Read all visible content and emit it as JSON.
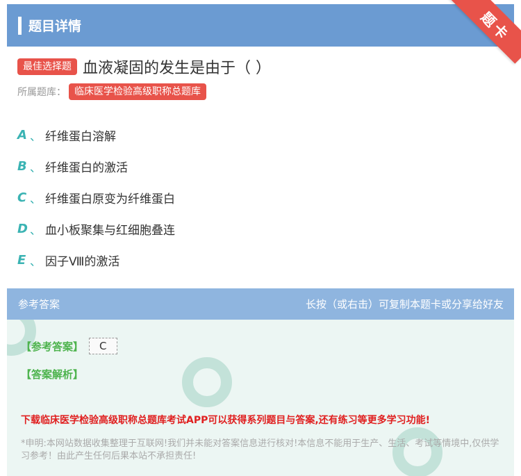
{
  "header": {
    "title": "题目详情"
  },
  "corner": {
    "label": "题卡"
  },
  "question": {
    "type_badge": "最佳选择题",
    "text": "血液凝固的发生是由于（ ）",
    "bank_label": "所属题库：",
    "bank_name": "临床医学检验高级职称总题库"
  },
  "options": [
    {
      "letter": "A",
      "sep": "、",
      "text": "纤维蛋白溶解"
    },
    {
      "letter": "B",
      "sep": "、",
      "text": "纤维蛋白的激活"
    },
    {
      "letter": "C",
      "sep": "、",
      "text": "纤维蛋白原变为纤维蛋白"
    },
    {
      "letter": "D",
      "sep": "、",
      "text": "血小板聚集与红细胞叠连"
    },
    {
      "letter": "E",
      "sep": "、",
      "text": "因子Ⅷ的激活"
    }
  ],
  "answer_section": {
    "title": "参考答案",
    "hint": "长按（或右击）可复制本题卡或分享给好友",
    "answer_label": "【参考答案】",
    "answer_value": "C",
    "analysis_label": "【答案解析】",
    "promo": "下载临床医学检验高级职称总题库考试APP可以获得系列题目与答案,还有练习等更多学习功能!",
    "disclaimer": "*申明:本网站数据收集整理于互联网!我们并未能对答案信息进行核对!本信息不能用于生产、生活、考试等情境中,仅供学习参考！由此产生任何后果本站不承担责任!"
  },
  "colors": {
    "header_bg": "#6b9bd2",
    "accent_red": "#e8534a",
    "option_letter": "#3bb3b3",
    "answer_green": "#4db34d",
    "promo_red": "#e02020"
  }
}
